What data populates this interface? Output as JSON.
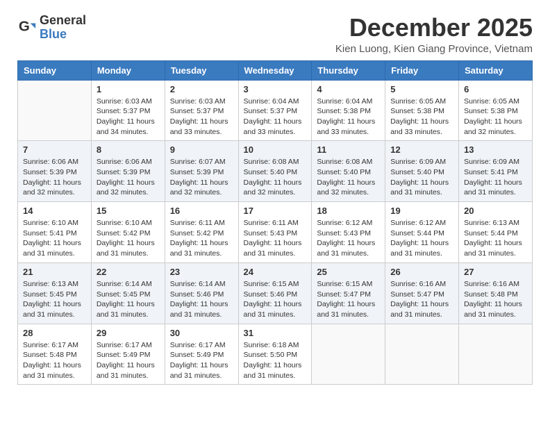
{
  "logo": {
    "general": "General",
    "blue": "Blue"
  },
  "title": {
    "month": "December 2025",
    "location": "Kien Luong, Kien Giang Province, Vietnam"
  },
  "headers": [
    "Sunday",
    "Monday",
    "Tuesday",
    "Wednesday",
    "Thursday",
    "Friday",
    "Saturday"
  ],
  "weeks": [
    [
      {
        "day": "",
        "info": ""
      },
      {
        "day": "1",
        "info": "Sunrise: 6:03 AM\nSunset: 5:37 PM\nDaylight: 11 hours\nand 34 minutes."
      },
      {
        "day": "2",
        "info": "Sunrise: 6:03 AM\nSunset: 5:37 PM\nDaylight: 11 hours\nand 33 minutes."
      },
      {
        "day": "3",
        "info": "Sunrise: 6:04 AM\nSunset: 5:37 PM\nDaylight: 11 hours\nand 33 minutes."
      },
      {
        "day": "4",
        "info": "Sunrise: 6:04 AM\nSunset: 5:38 PM\nDaylight: 11 hours\nand 33 minutes."
      },
      {
        "day": "5",
        "info": "Sunrise: 6:05 AM\nSunset: 5:38 PM\nDaylight: 11 hours\nand 33 minutes."
      },
      {
        "day": "6",
        "info": "Sunrise: 6:05 AM\nSunset: 5:38 PM\nDaylight: 11 hours\nand 32 minutes."
      }
    ],
    [
      {
        "day": "7",
        "info": "Sunrise: 6:06 AM\nSunset: 5:39 PM\nDaylight: 11 hours\nand 32 minutes."
      },
      {
        "day": "8",
        "info": "Sunrise: 6:06 AM\nSunset: 5:39 PM\nDaylight: 11 hours\nand 32 minutes."
      },
      {
        "day": "9",
        "info": "Sunrise: 6:07 AM\nSunset: 5:39 PM\nDaylight: 11 hours\nand 32 minutes."
      },
      {
        "day": "10",
        "info": "Sunrise: 6:08 AM\nSunset: 5:40 PM\nDaylight: 11 hours\nand 32 minutes."
      },
      {
        "day": "11",
        "info": "Sunrise: 6:08 AM\nSunset: 5:40 PM\nDaylight: 11 hours\nand 32 minutes."
      },
      {
        "day": "12",
        "info": "Sunrise: 6:09 AM\nSunset: 5:40 PM\nDaylight: 11 hours\nand 31 minutes."
      },
      {
        "day": "13",
        "info": "Sunrise: 6:09 AM\nSunset: 5:41 PM\nDaylight: 11 hours\nand 31 minutes."
      }
    ],
    [
      {
        "day": "14",
        "info": "Sunrise: 6:10 AM\nSunset: 5:41 PM\nDaylight: 11 hours\nand 31 minutes."
      },
      {
        "day": "15",
        "info": "Sunrise: 6:10 AM\nSunset: 5:42 PM\nDaylight: 11 hours\nand 31 minutes."
      },
      {
        "day": "16",
        "info": "Sunrise: 6:11 AM\nSunset: 5:42 PM\nDaylight: 11 hours\nand 31 minutes."
      },
      {
        "day": "17",
        "info": "Sunrise: 6:11 AM\nSunset: 5:43 PM\nDaylight: 11 hours\nand 31 minutes."
      },
      {
        "day": "18",
        "info": "Sunrise: 6:12 AM\nSunset: 5:43 PM\nDaylight: 11 hours\nand 31 minutes."
      },
      {
        "day": "19",
        "info": "Sunrise: 6:12 AM\nSunset: 5:44 PM\nDaylight: 11 hours\nand 31 minutes."
      },
      {
        "day": "20",
        "info": "Sunrise: 6:13 AM\nSunset: 5:44 PM\nDaylight: 11 hours\nand 31 minutes."
      }
    ],
    [
      {
        "day": "21",
        "info": "Sunrise: 6:13 AM\nSunset: 5:45 PM\nDaylight: 11 hours\nand 31 minutes."
      },
      {
        "day": "22",
        "info": "Sunrise: 6:14 AM\nSunset: 5:45 PM\nDaylight: 11 hours\nand 31 minutes."
      },
      {
        "day": "23",
        "info": "Sunrise: 6:14 AM\nSunset: 5:46 PM\nDaylight: 11 hours\nand 31 minutes."
      },
      {
        "day": "24",
        "info": "Sunrise: 6:15 AM\nSunset: 5:46 PM\nDaylight: 11 hours\nand 31 minutes."
      },
      {
        "day": "25",
        "info": "Sunrise: 6:15 AM\nSunset: 5:47 PM\nDaylight: 11 hours\nand 31 minutes."
      },
      {
        "day": "26",
        "info": "Sunrise: 6:16 AM\nSunset: 5:47 PM\nDaylight: 11 hours\nand 31 minutes."
      },
      {
        "day": "27",
        "info": "Sunrise: 6:16 AM\nSunset: 5:48 PM\nDaylight: 11 hours\nand 31 minutes."
      }
    ],
    [
      {
        "day": "28",
        "info": "Sunrise: 6:17 AM\nSunset: 5:48 PM\nDaylight: 11 hours\nand 31 minutes."
      },
      {
        "day": "29",
        "info": "Sunrise: 6:17 AM\nSunset: 5:49 PM\nDaylight: 11 hours\nand 31 minutes."
      },
      {
        "day": "30",
        "info": "Sunrise: 6:17 AM\nSunset: 5:49 PM\nDaylight: 11 hours\nand 31 minutes."
      },
      {
        "day": "31",
        "info": "Sunrise: 6:18 AM\nSunset: 5:50 PM\nDaylight: 11 hours\nand 31 minutes."
      },
      {
        "day": "",
        "info": ""
      },
      {
        "day": "",
        "info": ""
      },
      {
        "day": "",
        "info": ""
      }
    ]
  ]
}
